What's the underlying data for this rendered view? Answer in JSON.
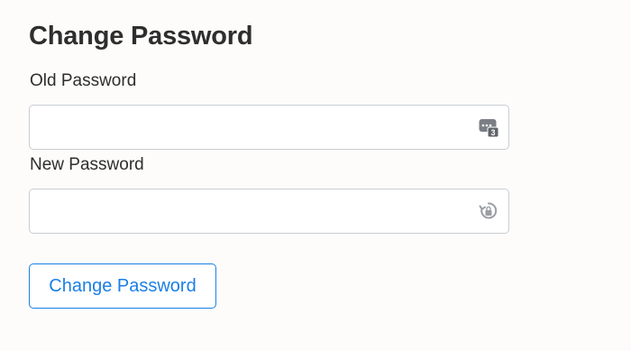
{
  "form": {
    "title": "Change Password",
    "old_password": {
      "label": "Old Password",
      "value": "",
      "placeholder": "",
      "icon": "password-manager-icon"
    },
    "new_password": {
      "label": "New Password",
      "value": "",
      "placeholder": "",
      "icon": "generate-password-icon"
    },
    "submit_label": "Change Password"
  },
  "colors": {
    "accent": "#1a7fe6",
    "text": "#2e2e2e",
    "border": "#c9cdd3",
    "background": "#fdfcfb"
  }
}
